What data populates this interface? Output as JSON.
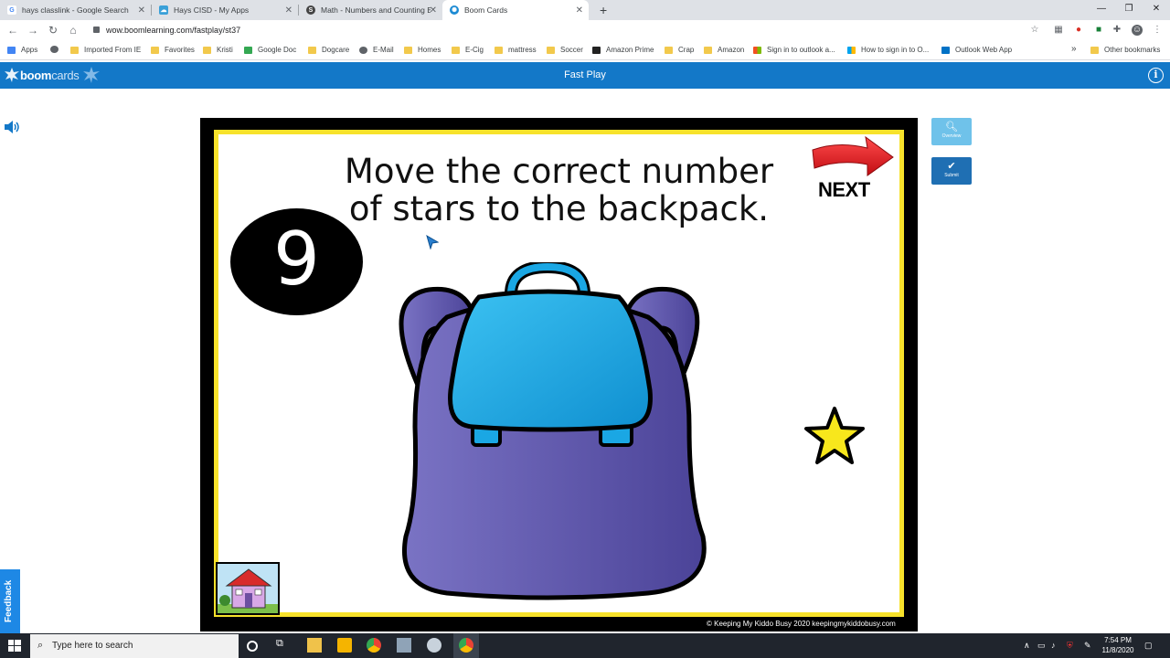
{
  "browser": {
    "tabs": [
      {
        "title": "hays classlink - Google Search",
        "icon": "google-icon"
      },
      {
        "title": "Hays CISD - My Apps",
        "icon": "classlink-icon"
      },
      {
        "title": "Math - Numbers and Counting B",
        "icon": "schoology-icon"
      },
      {
        "title": "Boom Cards",
        "icon": "boom-icon",
        "active": true
      }
    ],
    "new_tab": "+",
    "url": "wow.boomlearning.com/fastplay/st37",
    "bookmarks": [
      "Apps",
      "Imported From IE",
      "Favorites",
      "Kristi",
      "Google Doc",
      "Dogcare",
      "E-Mail",
      "Homes",
      "E-Cig",
      "mattress",
      "Soccer",
      "Amazon Prime",
      "Crap",
      "Amazon",
      "Sign in to outlook a...",
      "How to sign in to O...",
      "Outlook Web App"
    ],
    "other_bookmarks": "Other bookmarks",
    "more": "»"
  },
  "boom": {
    "logo_bold": "boom",
    "logo_light": "cards",
    "header_title": "Fast Play",
    "info": "i"
  },
  "card": {
    "instruction_line1": "Move the correct number",
    "instruction_line2": "of stars to the backpack.",
    "number": "9",
    "next_label": "NEXT",
    "copyright": "© Keeping My Kiddo Busy 2020 keepingmykiddobusy.com"
  },
  "side": {
    "overview_label": "Overview",
    "submit_label": "Submit"
  },
  "feedback": "Feedback",
  "taskbar": {
    "search_placeholder": "Type here to search",
    "time": "7:54 PM",
    "date": "11/8/2020"
  },
  "colors": {
    "boom_blue": "#1378c8",
    "card_yellow": "#f7e22b",
    "backpack_purple": "#6c63b5",
    "backpack_flap": "#1aa7e4",
    "star_yellow": "#f8e71c",
    "arrow_red": "#e0141e"
  }
}
